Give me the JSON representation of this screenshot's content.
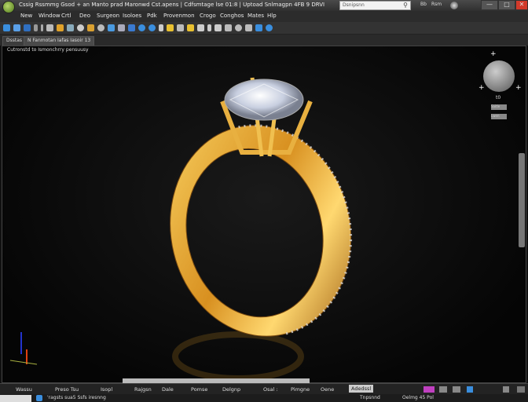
{
  "window": {
    "title": "Cssig Rssmmg Gsod + an Manto prad Maronwd Cst.apens | Cdfsmtage lse 01:8 | Uptoad Snlmagpn 4FB 9 DRVI"
  },
  "search": {
    "placeholder": "Dsnipsnn"
  },
  "window_controls": {
    "minimize": "—",
    "maximize": "□",
    "close": "✕",
    "extra_1": "Bb",
    "extra_2": "Rsm"
  },
  "menu": [
    "New",
    "Window",
    "Crtl",
    "Deo",
    "Surgeon",
    "Isoloes",
    "Pdk",
    "Provenmon",
    "Crogo",
    "Conghos",
    "Mates",
    "Hlp"
  ],
  "tabs": [
    {
      "label": "Dsstas",
      "active": false
    },
    {
      "label": "N Fanmotan Iafas Iasoir 13",
      "active": true
    }
  ],
  "viewport": {
    "label": "Cutronstd to Ismonchrry pensuusy",
    "gumball_label": "t0",
    "gumball_buttons": [
      "Saitle",
      "Lwen"
    ]
  },
  "status": {
    "items": [
      "Wassu",
      "Preso Tsu",
      "Isopl",
      "Rajgsn",
      "Dale",
      "Pomse",
      "Delgnp",
      "Osal :",
      "Pimgne",
      "Oene"
    ],
    "active": "Adedssl"
  },
  "bottom": {
    "text": "'ragsts sua5 Ssfs iresnng",
    "right_1": "Tnpsnnd",
    "right_2": "Oelmg 45 Pol"
  },
  "colors": {
    "gold": "#e0a22a",
    "accent_blue": "#3a8ede",
    "close_red": "#d23a2a"
  }
}
